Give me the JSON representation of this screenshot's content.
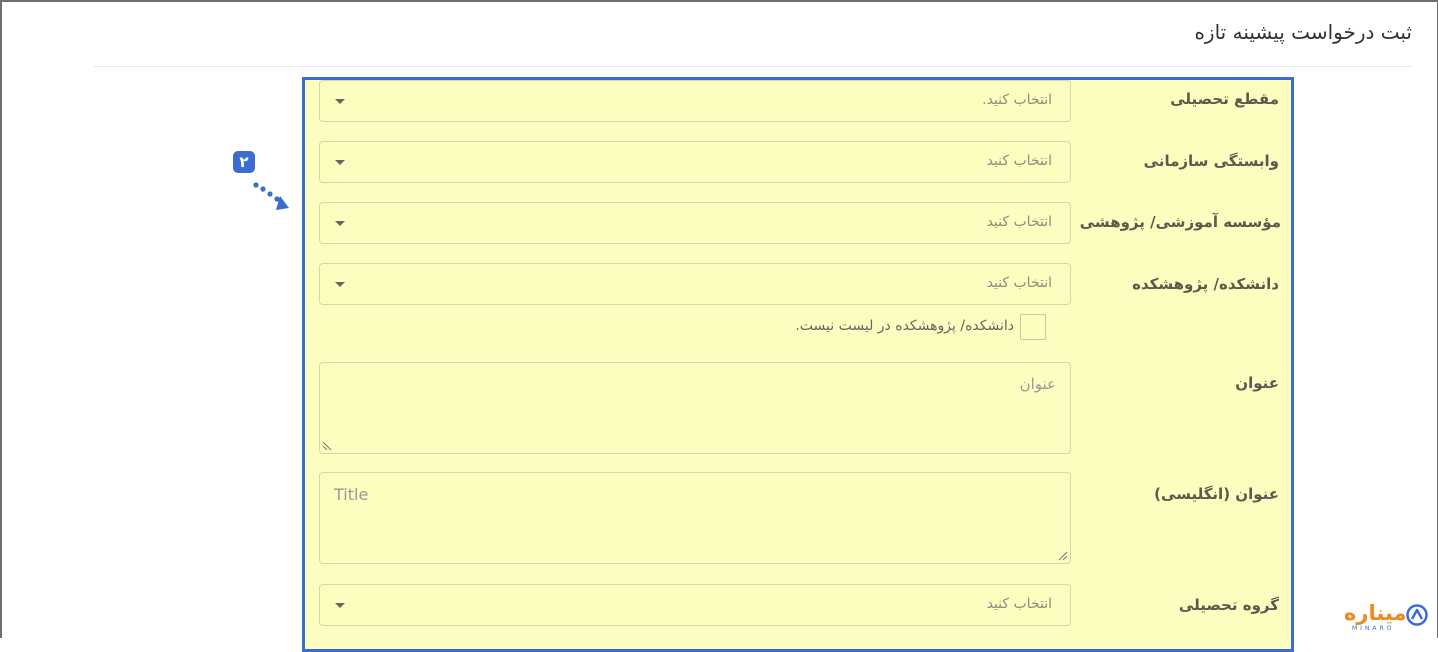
{
  "page": {
    "title": "ثبت درخواست پیشینه تازه"
  },
  "form": {
    "fields": [
      {
        "label": "مقطع تحصیلی",
        "placeholder": "انتخاب کنید."
      },
      {
        "label": "وابستگی سازمانی",
        "placeholder": "انتخاب کنید"
      },
      {
        "label": "مؤسسه آموزشی/ پژوهشی",
        "placeholder": "انتخاب کنید"
      },
      {
        "label": "دانشکده/ پژوهشکده",
        "placeholder": "انتخاب کنید"
      },
      {
        "label": "عنوان",
        "placeholder": "عنوان"
      },
      {
        "label": "عنوان (انگلیسی)",
        "placeholder": "Title"
      },
      {
        "label": "گروه تحصیلی",
        "placeholder": "انتخاب کنید"
      }
    ],
    "faculty_not_listed": {
      "label": "دانشکده/ پژوهشکده در لیست نیست.",
      "checked": false
    }
  },
  "annotation": {
    "step_number": "۲"
  },
  "brand": {
    "name": "میناره",
    "subtitle": "MINARO"
  },
  "colors": {
    "highlight_bg": "#fdfdbf",
    "highlight_border": "#3b6ccf",
    "brand_orange": "#ef8a1e"
  }
}
